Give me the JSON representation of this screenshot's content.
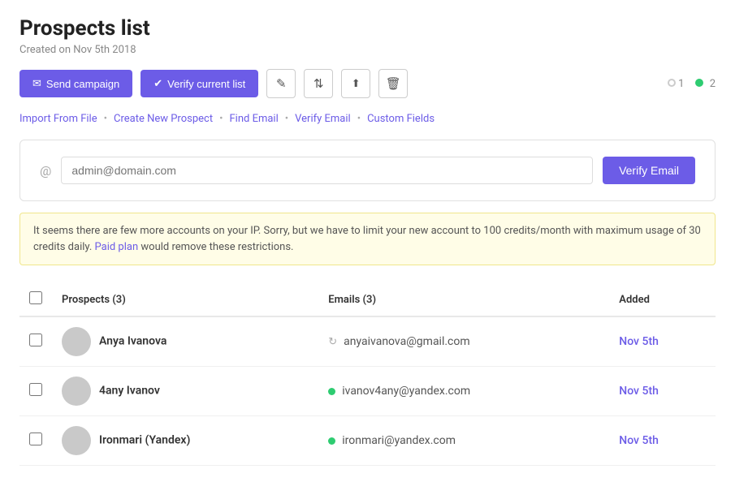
{
  "page": {
    "title": "Prospects list",
    "subtitle": "Created on Nov 5th 2018"
  },
  "toolbar": {
    "send_campaign_label": "Send campaign",
    "verify_list_label": "Verify current list",
    "edit_icon": "✎",
    "filter_icon": "⇅",
    "upload_icon": "↑",
    "trash_icon": "🗑",
    "status1": "1",
    "status2": "2"
  },
  "nav": {
    "import_label": "Import From File",
    "create_label": "Create New Prospect",
    "find_label": "Find Email",
    "verify_label": "Verify Email",
    "custom_label": "Custom Fields"
  },
  "verify_section": {
    "at_symbol": "@",
    "placeholder": "admin@domain.com",
    "button_label": "Verify Email"
  },
  "warning": {
    "text1": "It seems there are few more accounts on your IP. Sorry, but we have to limit your new account to 100 credits/month with maximum usage of 30 credits daily. ",
    "link_text": "Paid plan",
    "text2": " would remove these restrictions."
  },
  "table": {
    "col_prospects": "Prospects (3)",
    "col_emails": "Emails (3)",
    "col_added": "Added",
    "rows": [
      {
        "name": "Anya Ivanova",
        "email": "anyaivanova@gmail.com",
        "email_status": "refresh",
        "added_prefix": "Nov ",
        "added_date": "5th"
      },
      {
        "name": "4any Ivanov",
        "email": "ivanov4any@yandex.com",
        "email_status": "green",
        "added_prefix": "Nov ",
        "added_date": "5th"
      },
      {
        "name": "Ironmari (Yandex)",
        "email": "ironmari@yandex.com",
        "email_status": "green",
        "added_prefix": "Nov ",
        "added_date": "5th"
      }
    ]
  },
  "colors": {
    "accent": "#6c5ce7",
    "green": "#2ecc71",
    "gray": "#c9c9c9",
    "warning_bg": "#fffde7",
    "status_empty": "#ccc"
  }
}
